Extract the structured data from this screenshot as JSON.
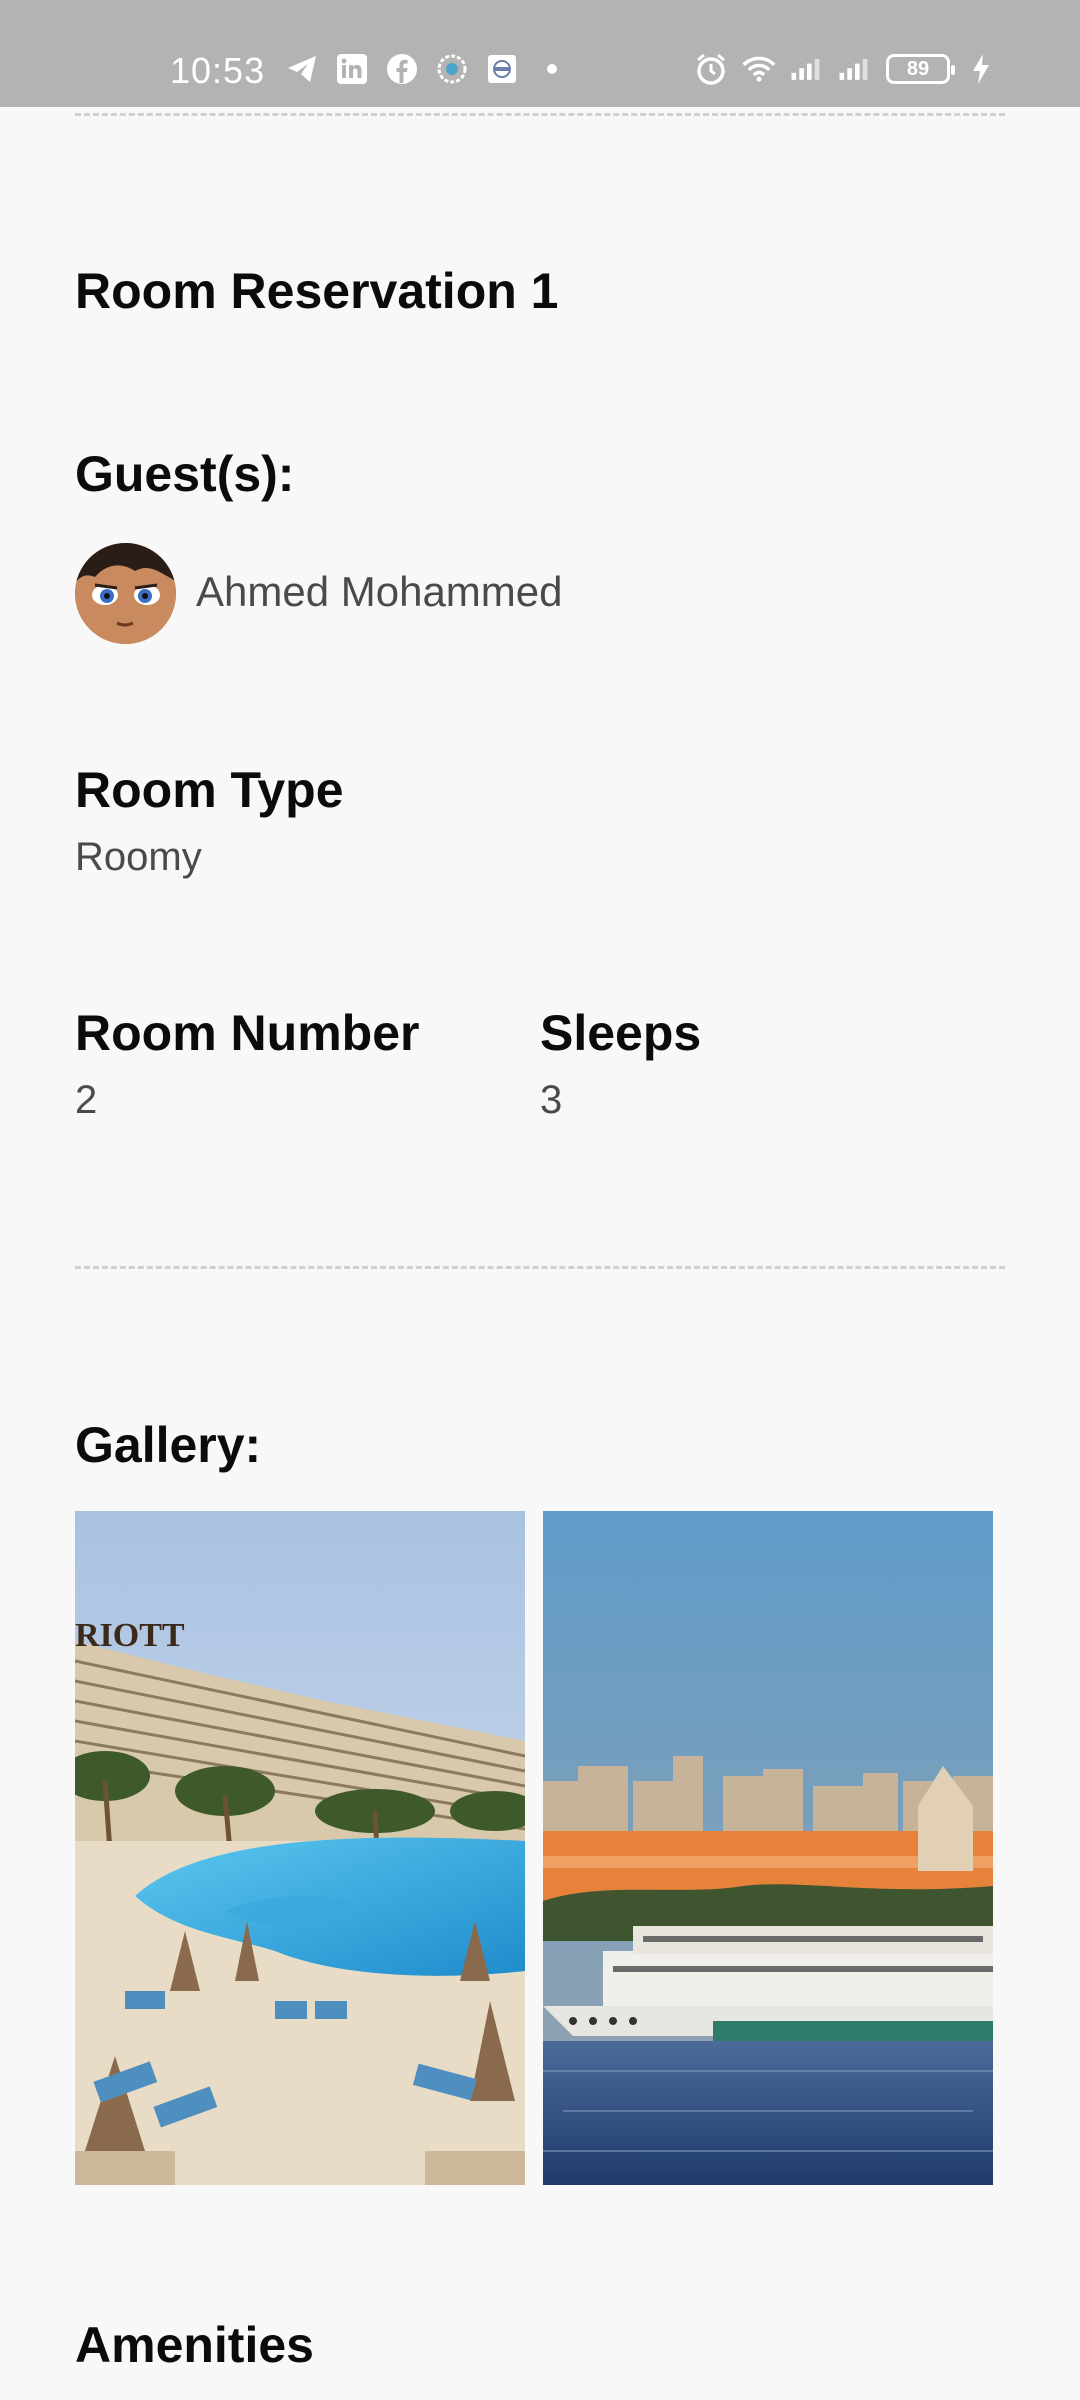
{
  "status_bar": {
    "time": "10:53",
    "battery": "89",
    "icons_left": [
      "telegram-icon",
      "linkedin-icon",
      "facebook-icon",
      "app-icon",
      "app-icon",
      "dot"
    ],
    "icons_right": [
      "alarm-icon",
      "wifi-icon",
      "signal-icon",
      "signal-icon",
      "battery-icon",
      "charging-icon"
    ]
  },
  "reservation": {
    "title": "Room Reservation 1",
    "guests_label": "Guest(s):",
    "guest_name": "Ahmed Mohammed",
    "room_type_label": "Room Type",
    "room_type_value": "Roomy",
    "room_number_label": "Room Number",
    "room_number_value": "2",
    "sleeps_label": "Sleeps",
    "sleeps_value": "3"
  },
  "gallery": {
    "label": "Gallery:",
    "images": [
      {
        "name": "hotel-pool-photo",
        "sign_text": "RIOTT"
      },
      {
        "name": "nile-river-photo"
      }
    ]
  },
  "amenities": {
    "label": "Amenities"
  },
  "colors": {
    "background": "#f8f8f9",
    "status_bar": "#b3b3b3",
    "heading_text": "#0b0b0b",
    "value_text": "#4a4a4a",
    "divider": "#cfd0d4"
  }
}
